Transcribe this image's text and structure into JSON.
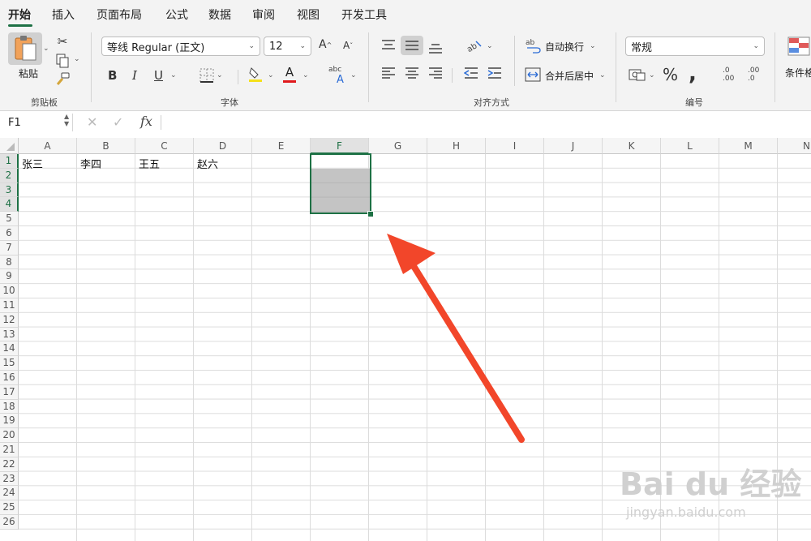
{
  "ribbon_tabs": [
    "开始",
    "插入",
    "页面布局",
    "公式",
    "数据",
    "审阅",
    "视图",
    "开发工具"
  ],
  "clipboard": {
    "paste_label": "粘贴",
    "group_label": "剪贴板"
  },
  "font": {
    "name": "等线 Regular (正文)",
    "size": "12",
    "group_label": "字体",
    "grow": "A",
    "shrink": "A",
    "bold": "B",
    "italic": "I",
    "underline": "U",
    "font_color_glyph": "A",
    "phonetic_glyph": "abc",
    "fill_color": "#f5e01a",
    "font_color": "#e0191c"
  },
  "alignment": {
    "wrap_label": "自动换行",
    "merge_label": "合并后居中",
    "group_label": "对齐方式"
  },
  "number": {
    "format": "常规",
    "group_label": "编号",
    "percent": "%",
    "comma": ",",
    "inc_decimal": ".0\n.00",
    "dec_decimal": ".00\n.0"
  },
  "styles": {
    "cond_format_label": "条件格"
  },
  "formula_bar": {
    "name_box": "F1",
    "fx": "fx",
    "cancel": "✕",
    "enter": "✓"
  },
  "columns": [
    "A",
    "B",
    "C",
    "D",
    "E",
    "F",
    "G",
    "H",
    "I",
    "J",
    "K",
    "L",
    "M",
    "N"
  ],
  "rows": [
    "1",
    "2",
    "3",
    "4",
    "5",
    "6",
    "7",
    "8",
    "9",
    "10",
    "11",
    "12",
    "13",
    "14",
    "15",
    "16",
    "17",
    "18",
    "19",
    "20",
    "21",
    "22",
    "23",
    "24",
    "25",
    "26"
  ],
  "cells": {
    "A1": "张三",
    "B1": "李四",
    "C1": "王五",
    "D1": "赵六"
  },
  "selection": {
    "range": "F1:F4",
    "highlighted": "F2:F4"
  },
  "annotation": {
    "arrow_color": "#f2462a"
  },
  "watermark": {
    "logo": "Bai du 经验",
    "url": "jingyan.baidu.com"
  },
  "accent": "#1e7145"
}
